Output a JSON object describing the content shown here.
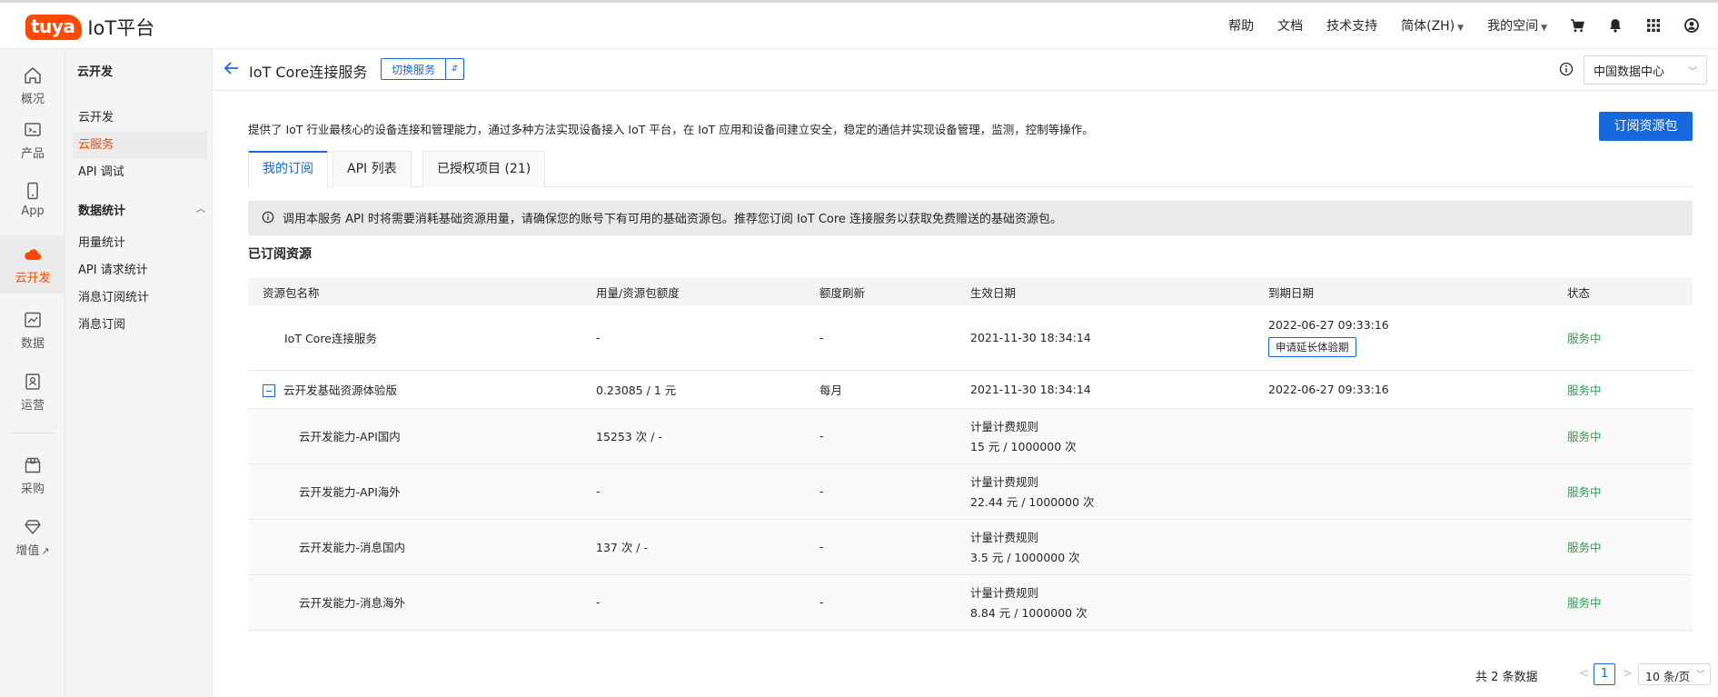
{
  "brand": {
    "badge": "tuya",
    "product": "IoT平台"
  },
  "topnav": {
    "help": "帮助",
    "docs": "文档",
    "support": "技术支持",
    "language": "简体(ZH)",
    "workspace": "我的空间"
  },
  "rail": [
    {
      "label": "概况",
      "icon": "home-icon"
    },
    {
      "label": "产品",
      "icon": "terminal-icon"
    },
    {
      "label": "App",
      "icon": "phone-icon"
    },
    {
      "label": "云开发",
      "icon": "cloud-icon"
    },
    {
      "label": "数据",
      "icon": "chart-icon"
    },
    {
      "label": "运营",
      "icon": "badge-icon"
    },
    {
      "label": "采购",
      "icon": "box-icon"
    },
    {
      "label": "增值",
      "icon": "diamond-icon"
    }
  ],
  "sidebar": {
    "title": "云开发",
    "items": [
      "云开发",
      "云服务",
      "API 调试"
    ],
    "group": "数据统计",
    "group_items": [
      "用量统计",
      "API 请求统计",
      "消息订阅统计",
      "消息订阅"
    ]
  },
  "header": {
    "title": "IoT Core连接服务",
    "switch_label": "切换服务",
    "region": "中国数据中心"
  },
  "main": {
    "description": "提供了 IoT 行业最核心的设备连接和管理能力，通过多种方法实现设备接入 IoT 平台，在 IoT 应用和设备间建立安全，稳定的通信并实现设备管理，监测，控制等操作。",
    "subscribe_button": "订阅资源包",
    "tabs": [
      "我的订阅",
      "API 列表",
      "已授权项目 (21)"
    ],
    "alert": "调用本服务 API 时将需要消耗基础资源用量，请确保您的账号下有可用的基础资源包。推荐您订阅 IoT Core 连接服务以获取免费赠送的基础资源包。",
    "section_title": "已订阅资源"
  },
  "table": {
    "headers": [
      "资源包名称",
      "用量/资源包额度",
      "额度刷新",
      "生效日期",
      "到期日期",
      "状态"
    ],
    "row1": {
      "name": "IoT Core连接服务",
      "usage": "-",
      "refresh": "-",
      "start": "2021-11-30 18:34:14",
      "end": "2022-06-27 09:33:16",
      "extend": "申请延长体验期",
      "status": "服务中"
    },
    "row2": {
      "name": "云开发基础资源体验版",
      "usage": "0.23085 / 1 元",
      "refresh": "每月",
      "start": "2021-11-30 18:34:14",
      "end": "2022-06-27 09:33:16",
      "status": "服务中"
    },
    "subrows": [
      {
        "name": "云开发能力-API国内",
        "usage": "15253 次 / -",
        "refresh": "-",
        "rule_title": "计量计费规则",
        "rule": "15 元 / 1000000 次",
        "status": "服务中"
      },
      {
        "name": "云开发能力-API海外",
        "usage": "-",
        "refresh": "-",
        "rule_title": "计量计费规则",
        "rule": "22.44 元 / 1000000 次",
        "status": "服务中"
      },
      {
        "name": "云开发能力-消息国内",
        "usage": "137 次 / -",
        "refresh": "-",
        "rule_title": "计量计费规则",
        "rule": "3.5 元 / 1000000 次",
        "status": "服务中"
      },
      {
        "name": "云开发能力-消息海外",
        "usage": "-",
        "refresh": "-",
        "rule_title": "计量计费规则",
        "rule": "8.84 元 / 1000000 次",
        "status": "服务中"
      }
    ]
  },
  "pagination": {
    "total": "共 2 条数据",
    "prev": "<",
    "current": "1",
    "next": ">",
    "page_size": "10 条/页"
  },
  "colors": {
    "brand": "#ff4800",
    "primary": "#1668dc",
    "success": "#2aa148"
  }
}
